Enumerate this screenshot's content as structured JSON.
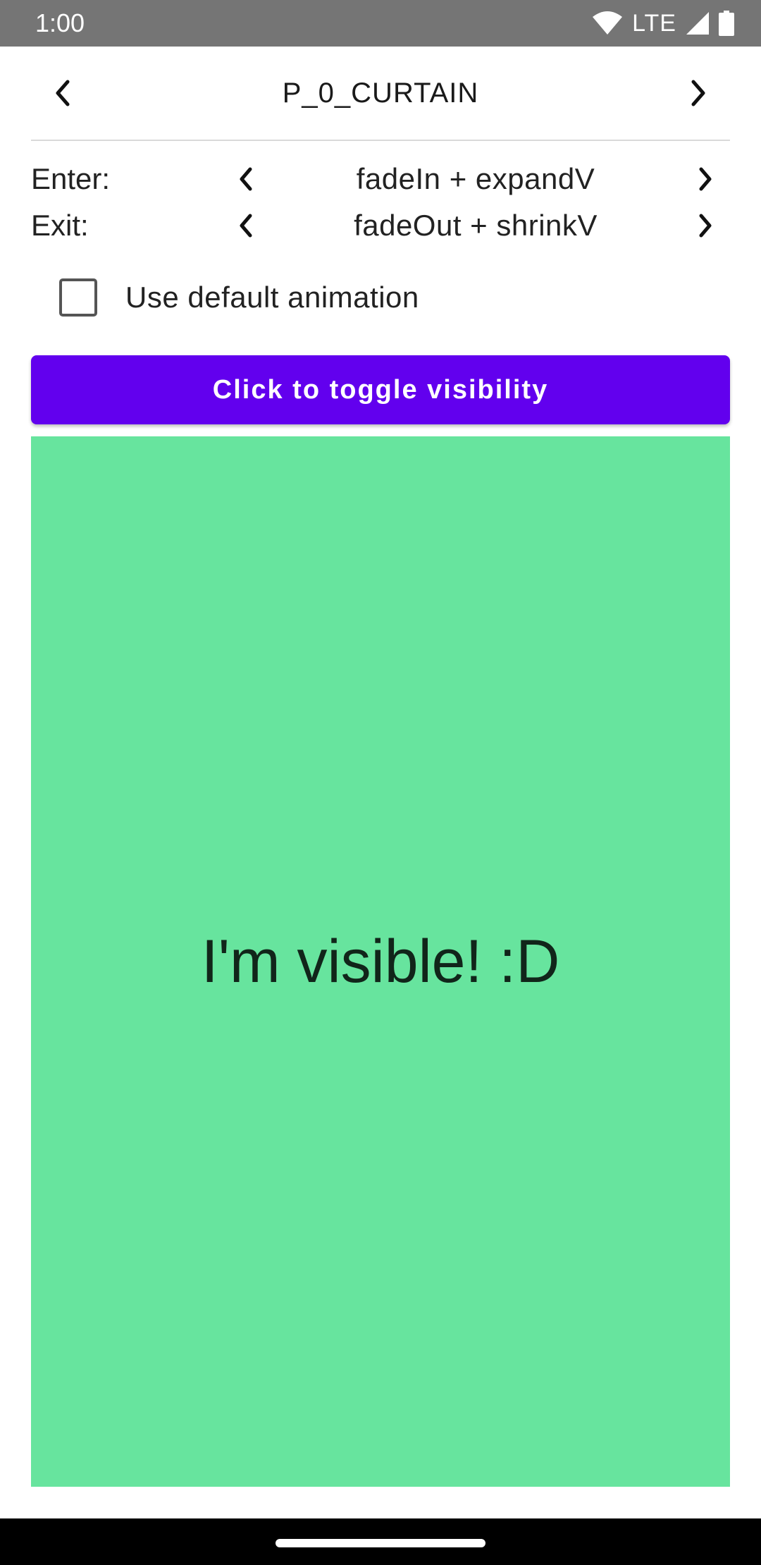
{
  "status_bar": {
    "time": "1:00",
    "network": "LTE",
    "icons": [
      "wifi-icon",
      "cell-signal-icon",
      "battery-icon"
    ]
  },
  "header": {
    "title": "P_0_CURTAIN",
    "prev_icon": "chevron-left-icon",
    "next_icon": "chevron-right-icon"
  },
  "enter": {
    "label": "Enter:",
    "value": "fadeIn + expandV"
  },
  "exit": {
    "label": "Exit:",
    "value": "fadeOut + shrinkV"
  },
  "default_animation": {
    "label": "Use default animation",
    "checked": false
  },
  "toggle_button": {
    "label": "Click to toggle visibility"
  },
  "content": {
    "text": "I'm visible! :D"
  },
  "colors": {
    "status_bar": "#757575",
    "button": "#6200ee",
    "content_box": "#67e49e",
    "nav_bar": "#000000"
  }
}
